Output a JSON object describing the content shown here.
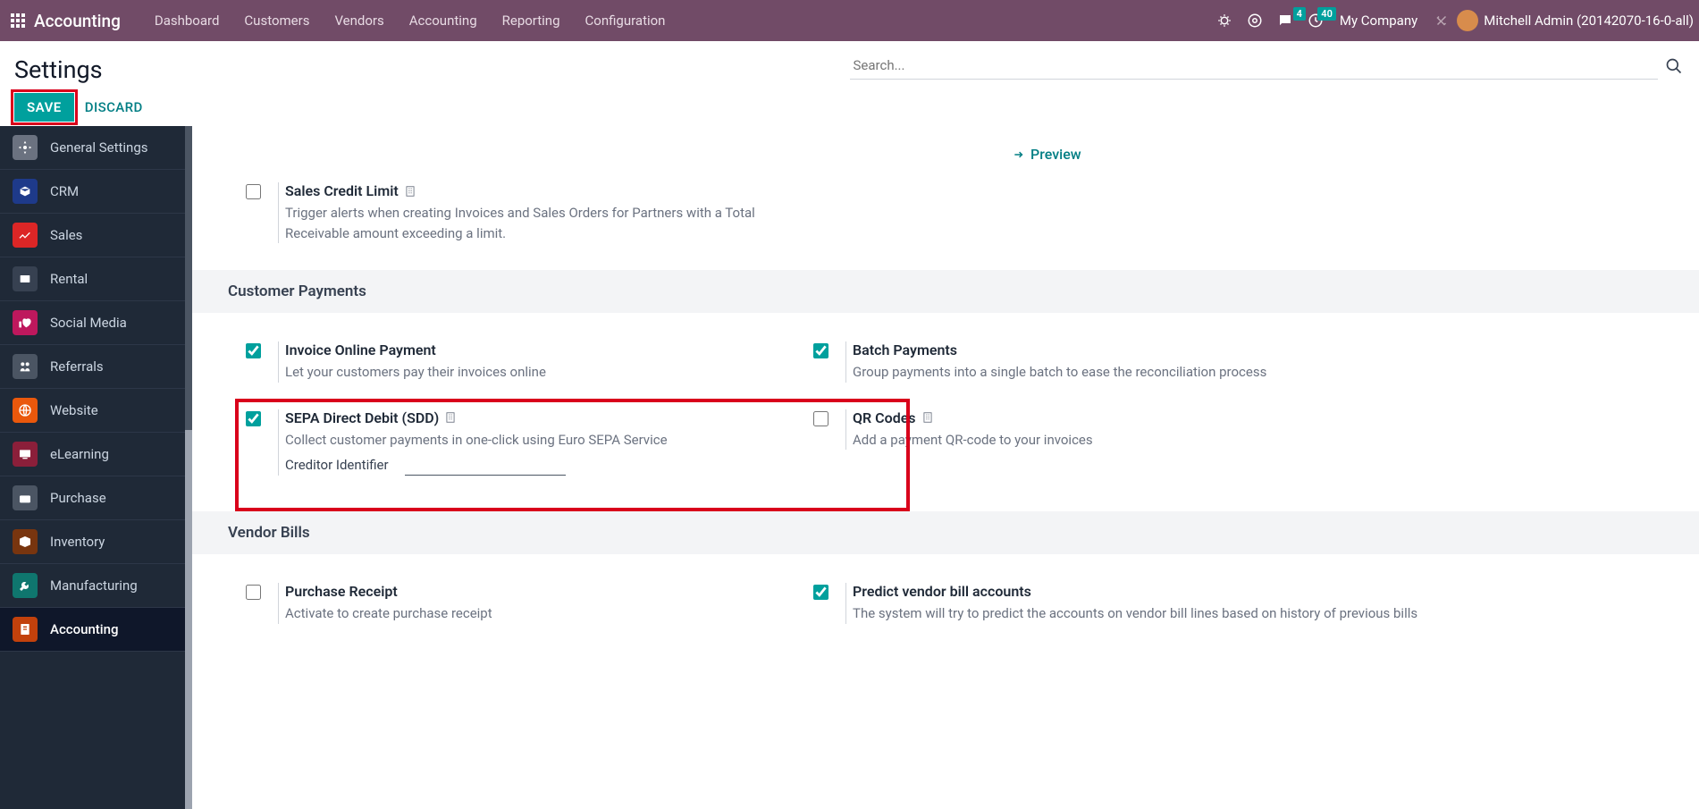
{
  "topbar": {
    "app": "Accounting",
    "nav": [
      "Dashboard",
      "Customers",
      "Vendors",
      "Accounting",
      "Reporting",
      "Configuration"
    ],
    "msg_badge": "4",
    "act_badge": "40",
    "company": "My Company",
    "user": "Mitchell Admin (20142070-16-0-all)"
  },
  "control": {
    "title": "Settings",
    "save": "SAVE",
    "discard": "DISCARD",
    "search_placeholder": "Search..."
  },
  "sidebar": [
    {
      "label": "General Settings"
    },
    {
      "label": "CRM"
    },
    {
      "label": "Sales"
    },
    {
      "label": "Rental"
    },
    {
      "label": "Social Media"
    },
    {
      "label": "Referrals"
    },
    {
      "label": "Website"
    },
    {
      "label": "eLearning"
    },
    {
      "label": "Purchase"
    },
    {
      "label": "Inventory"
    },
    {
      "label": "Manufacturing"
    },
    {
      "label": "Accounting"
    }
  ],
  "preview": "Preview",
  "salesCredit": {
    "title": "Sales Credit Limit",
    "desc": "Trigger alerts when creating Invoices and Sales Orders for Partners with a Total Receivable amount exceeding a limit."
  },
  "section_cp": "Customer Payments",
  "invoiceOnline": {
    "title": "Invoice Online Payment",
    "desc": "Let your customers pay their invoices online"
  },
  "batch": {
    "title": "Batch Payments",
    "desc": "Group payments into a single batch to ease the reconciliation process"
  },
  "sdd": {
    "title": "SEPA Direct Debit (SDD)",
    "desc": "Collect customer payments in one-click using Euro SEPA Service",
    "creditor": "Creditor Identifier"
  },
  "qr": {
    "title": "QR Codes",
    "desc": "Add a payment QR-code to your invoices"
  },
  "section_vb": "Vendor Bills",
  "receipt": {
    "title": "Purchase Receipt",
    "desc": "Activate to create purchase receipt"
  },
  "predict": {
    "title": "Predict vendor bill accounts",
    "desc": "The system will try to predict the accounts on vendor bill lines based on history of previous bills"
  },
  "colors": {
    "accent": "#00a09d",
    "danger": "#d9001b",
    "nav_bg": "#714b67",
    "sidebar_bg": "#1f2937"
  }
}
